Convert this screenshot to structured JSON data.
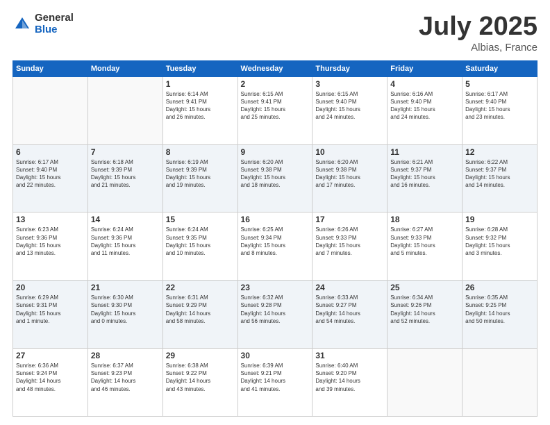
{
  "header": {
    "logo_general": "General",
    "logo_blue": "Blue",
    "month_year": "July 2025",
    "location": "Albias, France"
  },
  "days_of_week": [
    "Sunday",
    "Monday",
    "Tuesday",
    "Wednesday",
    "Thursday",
    "Friday",
    "Saturday"
  ],
  "weeks": [
    [
      {
        "day": "",
        "info": ""
      },
      {
        "day": "",
        "info": ""
      },
      {
        "day": "1",
        "info": "Sunrise: 6:14 AM\nSunset: 9:41 PM\nDaylight: 15 hours\nand 26 minutes."
      },
      {
        "day": "2",
        "info": "Sunrise: 6:15 AM\nSunset: 9:41 PM\nDaylight: 15 hours\nand 25 minutes."
      },
      {
        "day": "3",
        "info": "Sunrise: 6:15 AM\nSunset: 9:40 PM\nDaylight: 15 hours\nand 24 minutes."
      },
      {
        "day": "4",
        "info": "Sunrise: 6:16 AM\nSunset: 9:40 PM\nDaylight: 15 hours\nand 24 minutes."
      },
      {
        "day": "5",
        "info": "Sunrise: 6:17 AM\nSunset: 9:40 PM\nDaylight: 15 hours\nand 23 minutes."
      }
    ],
    [
      {
        "day": "6",
        "info": "Sunrise: 6:17 AM\nSunset: 9:40 PM\nDaylight: 15 hours\nand 22 minutes."
      },
      {
        "day": "7",
        "info": "Sunrise: 6:18 AM\nSunset: 9:39 PM\nDaylight: 15 hours\nand 21 minutes."
      },
      {
        "day": "8",
        "info": "Sunrise: 6:19 AM\nSunset: 9:39 PM\nDaylight: 15 hours\nand 19 minutes."
      },
      {
        "day": "9",
        "info": "Sunrise: 6:20 AM\nSunset: 9:38 PM\nDaylight: 15 hours\nand 18 minutes."
      },
      {
        "day": "10",
        "info": "Sunrise: 6:20 AM\nSunset: 9:38 PM\nDaylight: 15 hours\nand 17 minutes."
      },
      {
        "day": "11",
        "info": "Sunrise: 6:21 AM\nSunset: 9:37 PM\nDaylight: 15 hours\nand 16 minutes."
      },
      {
        "day": "12",
        "info": "Sunrise: 6:22 AM\nSunset: 9:37 PM\nDaylight: 15 hours\nand 14 minutes."
      }
    ],
    [
      {
        "day": "13",
        "info": "Sunrise: 6:23 AM\nSunset: 9:36 PM\nDaylight: 15 hours\nand 13 minutes."
      },
      {
        "day": "14",
        "info": "Sunrise: 6:24 AM\nSunset: 9:36 PM\nDaylight: 15 hours\nand 11 minutes."
      },
      {
        "day": "15",
        "info": "Sunrise: 6:24 AM\nSunset: 9:35 PM\nDaylight: 15 hours\nand 10 minutes."
      },
      {
        "day": "16",
        "info": "Sunrise: 6:25 AM\nSunset: 9:34 PM\nDaylight: 15 hours\nand 8 minutes."
      },
      {
        "day": "17",
        "info": "Sunrise: 6:26 AM\nSunset: 9:33 PM\nDaylight: 15 hours\nand 7 minutes."
      },
      {
        "day": "18",
        "info": "Sunrise: 6:27 AM\nSunset: 9:33 PM\nDaylight: 15 hours\nand 5 minutes."
      },
      {
        "day": "19",
        "info": "Sunrise: 6:28 AM\nSunset: 9:32 PM\nDaylight: 15 hours\nand 3 minutes."
      }
    ],
    [
      {
        "day": "20",
        "info": "Sunrise: 6:29 AM\nSunset: 9:31 PM\nDaylight: 15 hours\nand 1 minute."
      },
      {
        "day": "21",
        "info": "Sunrise: 6:30 AM\nSunset: 9:30 PM\nDaylight: 15 hours\nand 0 minutes."
      },
      {
        "day": "22",
        "info": "Sunrise: 6:31 AM\nSunset: 9:29 PM\nDaylight: 14 hours\nand 58 minutes."
      },
      {
        "day": "23",
        "info": "Sunrise: 6:32 AM\nSunset: 9:28 PM\nDaylight: 14 hours\nand 56 minutes."
      },
      {
        "day": "24",
        "info": "Sunrise: 6:33 AM\nSunset: 9:27 PM\nDaylight: 14 hours\nand 54 minutes."
      },
      {
        "day": "25",
        "info": "Sunrise: 6:34 AM\nSunset: 9:26 PM\nDaylight: 14 hours\nand 52 minutes."
      },
      {
        "day": "26",
        "info": "Sunrise: 6:35 AM\nSunset: 9:25 PM\nDaylight: 14 hours\nand 50 minutes."
      }
    ],
    [
      {
        "day": "27",
        "info": "Sunrise: 6:36 AM\nSunset: 9:24 PM\nDaylight: 14 hours\nand 48 minutes."
      },
      {
        "day": "28",
        "info": "Sunrise: 6:37 AM\nSunset: 9:23 PM\nDaylight: 14 hours\nand 46 minutes."
      },
      {
        "day": "29",
        "info": "Sunrise: 6:38 AM\nSunset: 9:22 PM\nDaylight: 14 hours\nand 43 minutes."
      },
      {
        "day": "30",
        "info": "Sunrise: 6:39 AM\nSunset: 9:21 PM\nDaylight: 14 hours\nand 41 minutes."
      },
      {
        "day": "31",
        "info": "Sunrise: 6:40 AM\nSunset: 9:20 PM\nDaylight: 14 hours\nand 39 minutes."
      },
      {
        "day": "",
        "info": ""
      },
      {
        "day": "",
        "info": ""
      }
    ]
  ]
}
